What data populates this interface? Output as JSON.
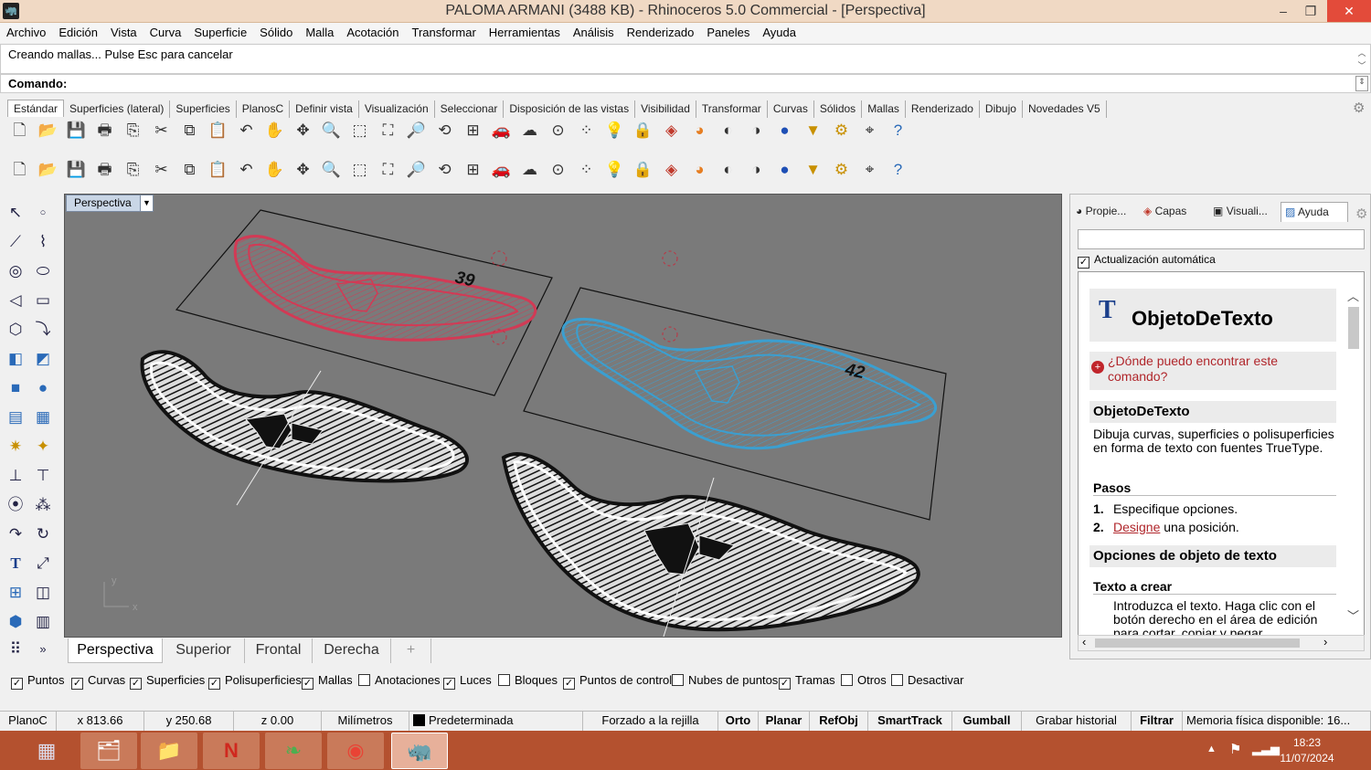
{
  "window": {
    "title": "PALOMA ARMANI (3488 KB) - Rhinoceros 5.0 Commercial - [Perspectiva]",
    "min": "–",
    "max": "❐",
    "close": "✕"
  },
  "menu": [
    "Archivo",
    "Edición",
    "Vista",
    "Curva",
    "Superficie",
    "Sólido",
    "Malla",
    "Acotación",
    "Transformar",
    "Herramientas",
    "Análisis",
    "Renderizado",
    "Paneles",
    "Ayuda"
  ],
  "command": {
    "history": "Creando mallas... Pulse Esc para cancelar",
    "prompt": "Comando:",
    "value": ""
  },
  "toolbar_tabs": [
    "Estándar",
    "Superficies (lateral)",
    "Superficies",
    "PlanosC",
    "Definir vista",
    "Visualización",
    "Seleccionar",
    "Disposición de las vistas",
    "Visibilidad",
    "Transformar",
    "Curvas",
    "Sólidos",
    "Mallas",
    "Renderizado",
    "Dibujo",
    "Novedades V5"
  ],
  "toolbar_icons": [
    "new-file-icon",
    "open-folder-icon",
    "save-icon",
    "print-icon",
    "import-icon",
    "cut-icon",
    "copy-icon",
    "paste-icon",
    "undo-icon",
    "pan-hand-icon",
    "move-view-icon",
    "zoom-icon",
    "zoom-window-icon",
    "zoom-extents-icon",
    "zoom-selected-icon",
    "rotate-view-icon",
    "viewports-icon",
    "car-icon",
    "hide-icon",
    "cplane-icon",
    "points-icon",
    "light-icon",
    "lock-icon",
    "layer-icon",
    "color-wheel-icon",
    "sphere-shade-icon",
    "sphere-render-icon",
    "sphere-blue-icon",
    "select-icon",
    "settings-icon",
    "osnap-icon",
    "help-icon"
  ],
  "viewport": {
    "label": "Perspectiva",
    "text_left": "39",
    "text_right": "42",
    "axis_y": "y",
    "axis_x": "x"
  },
  "view_tabs": [
    "Perspectiva",
    "Superior",
    "Frontal",
    "Derecha",
    "+"
  ],
  "panel": {
    "tabs": [
      "Propie...",
      "Capas",
      "Visuali...",
      "Ayuda"
    ],
    "auto_update": "Actualización automática",
    "help_title": "ObjetoDeTexto",
    "help_where": "¿Dónde puedo encontrar este comando?",
    "sec_name": "ObjetoDeTexto",
    "desc": "Dibuja curvas, superficies o polisuperficies en forma de texto con fuentes TrueType.",
    "steps_head": "Pasos",
    "step1_num": "1.",
    "step1": "Especifique opciones.",
    "step2_num": "2.",
    "step2_link": "Designe",
    "step2_rest": " una posición.",
    "options_head": "Opciones de objeto de texto",
    "text_head": "Texto a crear",
    "text_para": "Introduzca el texto. Haga clic con el botón derecho en el área de edición para cortar, copiar y pegar."
  },
  "filters": [
    {
      "label": "Puntos",
      "checked": true
    },
    {
      "label": "Curvas",
      "checked": true
    },
    {
      "label": "Superficies",
      "checked": true
    },
    {
      "label": "Polisuperficies",
      "checked": true
    },
    {
      "label": "Mallas",
      "checked": true
    },
    {
      "label": "Anotaciones",
      "checked": false
    },
    {
      "label": "Luces",
      "checked": true
    },
    {
      "label": "Bloques",
      "checked": false
    },
    {
      "label": "Puntos de control",
      "checked": true
    },
    {
      "label": "Nubes de puntos",
      "checked": false
    },
    {
      "label": "Tramas",
      "checked": true
    },
    {
      "label": "Otros",
      "checked": false
    },
    {
      "label": "Desactivar",
      "checked": false
    }
  ],
  "status": {
    "cplane": "PlanoC",
    "x": "x 813.66",
    "y": "y 250.68",
    "z": "z 0.00",
    "units": "Milímetros",
    "layer": "Predeterminada",
    "grid_snap": "Forzado a la rejilla",
    "ortho": "Orto",
    "planar": "Planar",
    "osnap": "RefObj",
    "smarttrack": "SmartTrack",
    "gumball": "Gumball",
    "history": "Grabar historial",
    "filter": "Filtrar",
    "memory": "Memoria física disponible: 16..."
  },
  "taskbar": {
    "time": "18:23",
    "date": "11/07/2024"
  }
}
